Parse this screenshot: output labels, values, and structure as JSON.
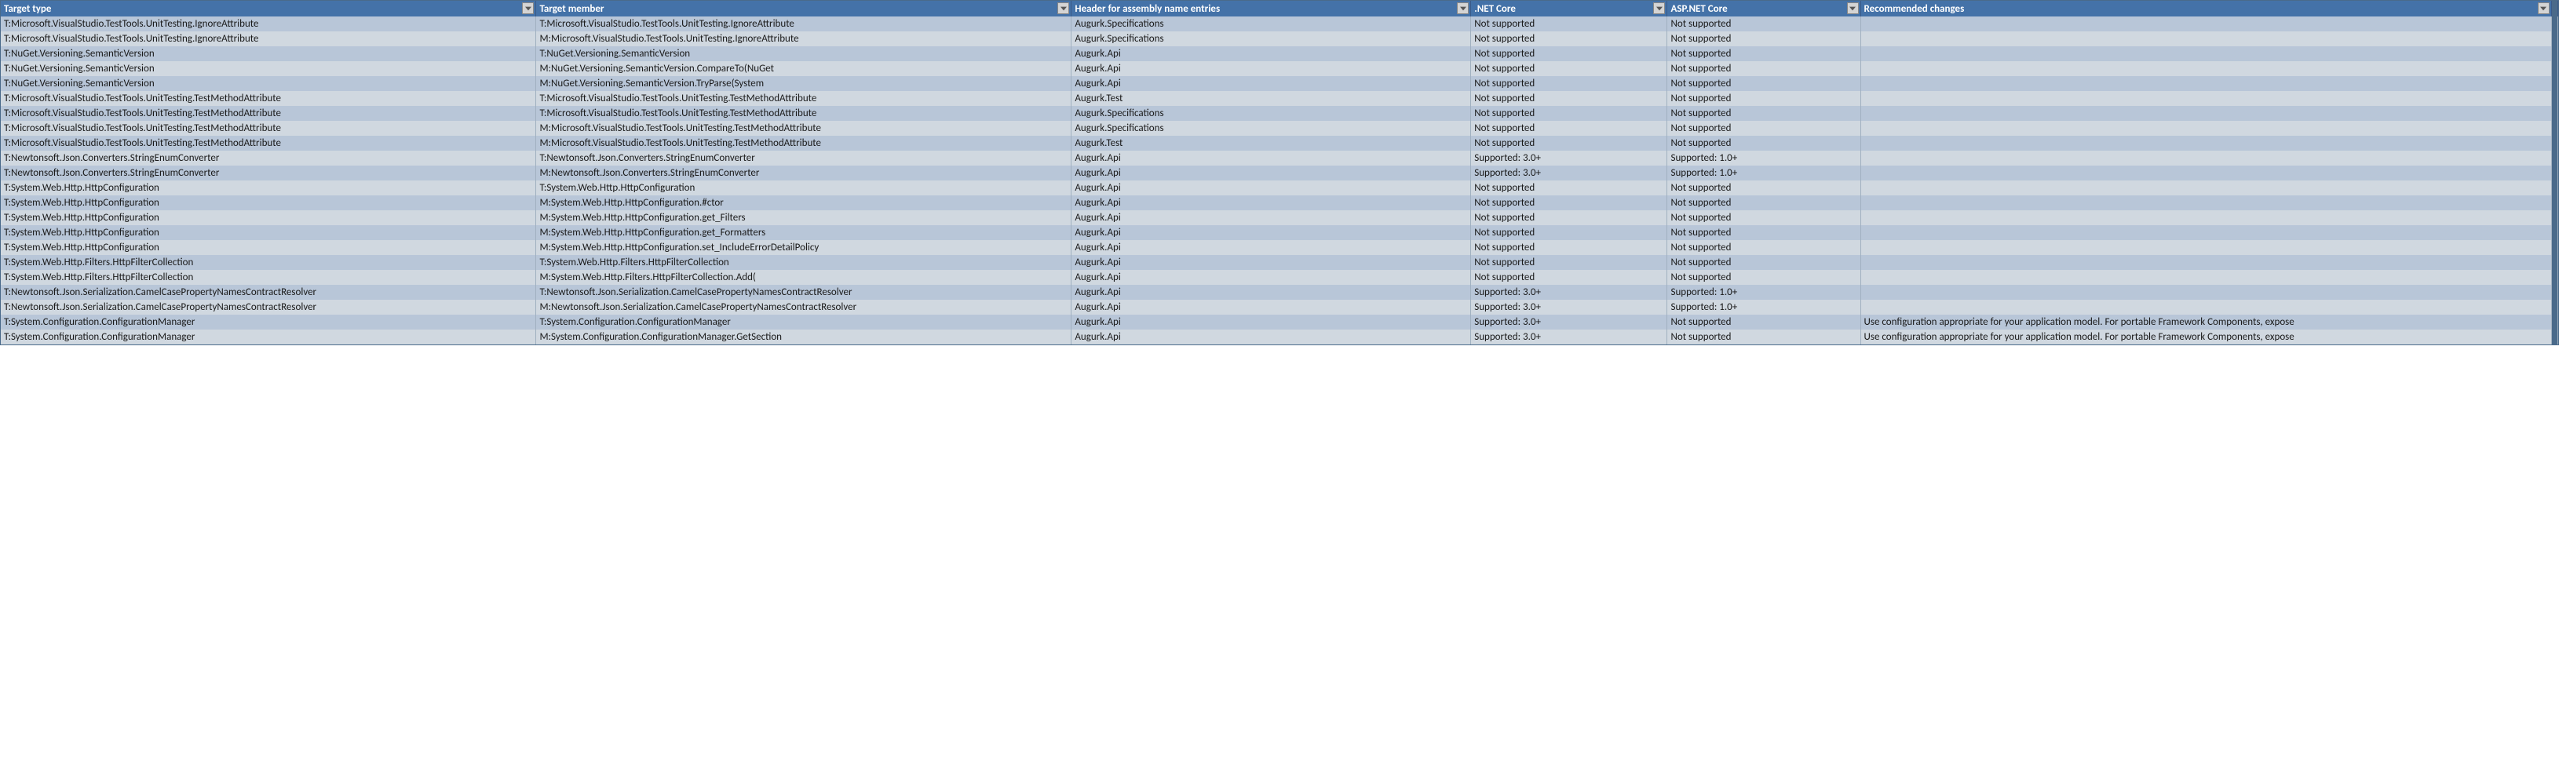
{
  "headers": [
    "Target type",
    "Target member",
    "Header for assembly name entries",
    ".NET Core",
    "ASP.NET Core",
    "Recommended changes"
  ],
  "rows": [
    {
      "target_type": "T:Microsoft.VisualStudio.TestTools.UnitTesting.IgnoreAttribute",
      "target_member": "T:Microsoft.VisualStudio.TestTools.UnitTesting.IgnoreAttribute",
      "assembly": "Augurk.Specifications",
      "net_core": "Not supported",
      "asp_net_core": "Not supported",
      "recommended": ""
    },
    {
      "target_type": "T:Microsoft.VisualStudio.TestTools.UnitTesting.IgnoreAttribute",
      "target_member": "M:Microsoft.VisualStudio.TestTools.UnitTesting.IgnoreAttribute",
      "assembly": "Augurk.Specifications",
      "net_core": "Not supported",
      "asp_net_core": "Not supported",
      "recommended": ""
    },
    {
      "target_type": "T:NuGet.Versioning.SemanticVersion",
      "target_member": "T:NuGet.Versioning.SemanticVersion",
      "assembly": "Augurk.Api",
      "net_core": "Not supported",
      "asp_net_core": "Not supported",
      "recommended": ""
    },
    {
      "target_type": "T:NuGet.Versioning.SemanticVersion",
      "target_member": "M:NuGet.Versioning.SemanticVersion.CompareTo(NuGet",
      "assembly": "Augurk.Api",
      "net_core": "Not supported",
      "asp_net_core": "Not supported",
      "recommended": ""
    },
    {
      "target_type": "T:NuGet.Versioning.SemanticVersion",
      "target_member": "M:NuGet.Versioning.SemanticVersion.TryParse(System",
      "assembly": "Augurk.Api",
      "net_core": "Not supported",
      "asp_net_core": "Not supported",
      "recommended": ""
    },
    {
      "target_type": "T:Microsoft.VisualStudio.TestTools.UnitTesting.TestMethodAttribute",
      "target_member": "T:Microsoft.VisualStudio.TestTools.UnitTesting.TestMethodAttribute",
      "assembly": "Augurk.Test",
      "net_core": "Not supported",
      "asp_net_core": "Not supported",
      "recommended": ""
    },
    {
      "target_type": "T:Microsoft.VisualStudio.TestTools.UnitTesting.TestMethodAttribute",
      "target_member": "T:Microsoft.VisualStudio.TestTools.UnitTesting.TestMethodAttribute",
      "assembly": "Augurk.Specifications",
      "net_core": "Not supported",
      "asp_net_core": "Not supported",
      "recommended": ""
    },
    {
      "target_type": "T:Microsoft.VisualStudio.TestTools.UnitTesting.TestMethodAttribute",
      "target_member": "M:Microsoft.VisualStudio.TestTools.UnitTesting.TestMethodAttribute",
      "assembly": "Augurk.Specifications",
      "net_core": "Not supported",
      "asp_net_core": "Not supported",
      "recommended": ""
    },
    {
      "target_type": "T:Microsoft.VisualStudio.TestTools.UnitTesting.TestMethodAttribute",
      "target_member": "M:Microsoft.VisualStudio.TestTools.UnitTesting.TestMethodAttribute",
      "assembly": "Augurk.Test",
      "net_core": "Not supported",
      "asp_net_core": "Not supported",
      "recommended": ""
    },
    {
      "target_type": "T:Newtonsoft.Json.Converters.StringEnumConverter",
      "target_member": "T:Newtonsoft.Json.Converters.StringEnumConverter",
      "assembly": "Augurk.Api",
      "net_core": "Supported: 3.0+",
      "asp_net_core": "Supported: 1.0+",
      "recommended": ""
    },
    {
      "target_type": "T:Newtonsoft.Json.Converters.StringEnumConverter",
      "target_member": "M:Newtonsoft.Json.Converters.StringEnumConverter",
      "assembly": "Augurk.Api",
      "net_core": "Supported: 3.0+",
      "asp_net_core": "Supported: 1.0+",
      "recommended": ""
    },
    {
      "target_type": "T:System.Web.Http.HttpConfiguration",
      "target_member": "T:System.Web.Http.HttpConfiguration",
      "assembly": "Augurk.Api",
      "net_core": "Not supported",
      "asp_net_core": "Not supported",
      "recommended": ""
    },
    {
      "target_type": "T:System.Web.Http.HttpConfiguration",
      "target_member": "M:System.Web.Http.HttpConfiguration.#ctor",
      "assembly": "Augurk.Api",
      "net_core": "Not supported",
      "asp_net_core": "Not supported",
      "recommended": ""
    },
    {
      "target_type": "T:System.Web.Http.HttpConfiguration",
      "target_member": "M:System.Web.Http.HttpConfiguration.get_Filters",
      "assembly": "Augurk.Api",
      "net_core": "Not supported",
      "asp_net_core": "Not supported",
      "recommended": ""
    },
    {
      "target_type": "T:System.Web.Http.HttpConfiguration",
      "target_member": "M:System.Web.Http.HttpConfiguration.get_Formatters",
      "assembly": "Augurk.Api",
      "net_core": "Not supported",
      "asp_net_core": "Not supported",
      "recommended": ""
    },
    {
      "target_type": "T:System.Web.Http.HttpConfiguration",
      "target_member": "M:System.Web.Http.HttpConfiguration.set_IncludeErrorDetailPolicy",
      "assembly": "Augurk.Api",
      "net_core": "Not supported",
      "asp_net_core": "Not supported",
      "recommended": ""
    },
    {
      "target_type": "T:System.Web.Http.Filters.HttpFilterCollection",
      "target_member": "T:System.Web.Http.Filters.HttpFilterCollection",
      "assembly": "Augurk.Api",
      "net_core": "Not supported",
      "asp_net_core": "Not supported",
      "recommended": ""
    },
    {
      "target_type": "T:System.Web.Http.Filters.HttpFilterCollection",
      "target_member": "M:System.Web.Http.Filters.HttpFilterCollection.Add(",
      "assembly": "Augurk.Api",
      "net_core": "Not supported",
      "asp_net_core": "Not supported",
      "recommended": ""
    },
    {
      "target_type": "T:Newtonsoft.Json.Serialization.CamelCasePropertyNamesContractResolver",
      "target_member": "T:Newtonsoft.Json.Serialization.CamelCasePropertyNamesContractResolver",
      "assembly": "Augurk.Api",
      "net_core": "Supported: 3.0+",
      "asp_net_core": "Supported: 1.0+",
      "recommended": ""
    },
    {
      "target_type": "T:Newtonsoft.Json.Serialization.CamelCasePropertyNamesContractResolver",
      "target_member": "M:Newtonsoft.Json.Serialization.CamelCasePropertyNamesContractResolver",
      "assembly": "Augurk.Api",
      "net_core": "Supported: 3.0+",
      "asp_net_core": "Supported: 1.0+",
      "recommended": ""
    },
    {
      "target_type": "T:System.Configuration.ConfigurationManager",
      "target_member": "T:System.Configuration.ConfigurationManager",
      "assembly": "Augurk.Api",
      "net_core": "Supported: 3.0+",
      "asp_net_core": "Not supported",
      "recommended": "Use configuration appropriate for your application model.  For portable Framework Components, expose"
    },
    {
      "target_type": "T:System.Configuration.ConfigurationManager",
      "target_member": "M:System.Configuration.ConfigurationManager.GetSection",
      "assembly": "Augurk.Api",
      "net_core": "Supported: 3.0+",
      "asp_net_core": "Not supported",
      "recommended": "Use configuration appropriate for your application model.  For portable Framework Components, expose"
    }
  ]
}
